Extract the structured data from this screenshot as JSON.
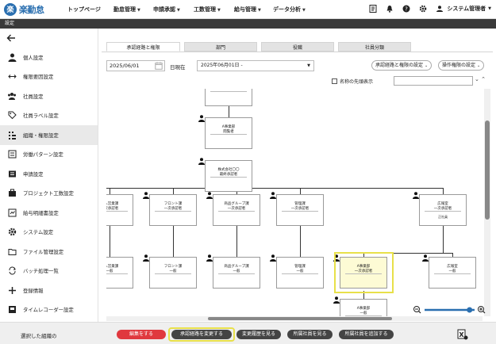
{
  "app": {
    "logo_mark": "楽",
    "logo_text": "楽勤怠"
  },
  "nav": [
    {
      "label": "トップページ",
      "dropdown": false
    },
    {
      "label": "勤怠管理",
      "dropdown": true
    },
    {
      "label": "申請承認",
      "dropdown": true
    },
    {
      "label": "工数管理",
      "dropdown": true
    },
    {
      "label": "給与管理",
      "dropdown": true
    },
    {
      "label": "データ分析",
      "dropdown": true
    }
  ],
  "user": {
    "name": "システム管理者"
  },
  "subbar": {
    "title": "設定"
  },
  "sidebar": {
    "items": [
      {
        "label": "個人設定",
        "icon": "person-icon"
      },
      {
        "label": "権限要因設定",
        "icon": "arrows-icon"
      },
      {
        "label": "社員設定",
        "icon": "group-icon"
      },
      {
        "label": "社員ラベル設定",
        "icon": "tag-icon"
      },
      {
        "label": "組織・権限設定",
        "icon": "org-icon",
        "active": true
      },
      {
        "label": "労働パターン設定",
        "icon": "list-icon"
      },
      {
        "label": "申請設定",
        "icon": "form-icon"
      },
      {
        "label": "プロジェクト工数設定",
        "icon": "briefcase-icon"
      },
      {
        "label": "給与明細書設定",
        "icon": "payslip-icon"
      },
      {
        "label": "システム設定",
        "icon": "gear-icon"
      },
      {
        "label": "ファイル管理設定",
        "icon": "folder-icon"
      },
      {
        "label": "バッチ処理一覧",
        "icon": "batch-icon"
      },
      {
        "label": "登録情報",
        "icon": "plus-icon"
      },
      {
        "label": "タイムレコーダー設定",
        "icon": "recorder-icon"
      }
    ]
  },
  "tabs": [
    {
      "label": "承認経路と権限",
      "active": true
    },
    {
      "label": "部門",
      "active": false
    },
    {
      "label": "役職",
      "active": false
    },
    {
      "label": "社員分類",
      "active": false
    }
  ],
  "filters": {
    "date": "2025/06/01",
    "as_of": "日現在",
    "range": "2025年06月01日 -",
    "approval_settings": "承認経路と権限の設定",
    "operation_settings": "操作権限の設定",
    "show_first_name": "名称の先頭表示"
  },
  "org": {
    "top": {
      "title": "",
      "role": "閲覧者"
    },
    "level1": {
      "title": "A事業部",
      "role": "閲覧者"
    },
    "level2": {
      "title": "株式会社〇〇",
      "role": "最終承認者"
    },
    "row1": [
      {
        "title": "法人営業課",
        "role": "一次承認者"
      },
      {
        "title": "フロント課",
        "role": "一次承認者"
      },
      {
        "title": "商品グループ課",
        "role": "一次承認者"
      },
      {
        "title": "管理課",
        "role": "一次承認者"
      },
      {
        "title": "広報室",
        "role": "一次承認者",
        "sub": "正社員"
      }
    ],
    "row2": [
      {
        "title": "法人営業課",
        "role": "一般"
      },
      {
        "title": "フロント課",
        "role": "一般"
      },
      {
        "title": "商品グループ課",
        "role": "一般"
      },
      {
        "title": "管理課",
        "role": "一般"
      },
      {
        "title": "A事業部",
        "role": "一次承認者"
      },
      {
        "title": "広報室",
        "role": "一般"
      }
    ],
    "row3": {
      "title": "A事業部",
      "role": "一般"
    }
  },
  "zoom_level": 0.9,
  "footer": {
    "selected_label": "選択した組織の",
    "edit": "編集をする",
    "change_route": "承認経路を変更する",
    "history": "変更履歴を見る",
    "view_members": "所属社員を見る",
    "add_members": "所属社員を追加する"
  }
}
